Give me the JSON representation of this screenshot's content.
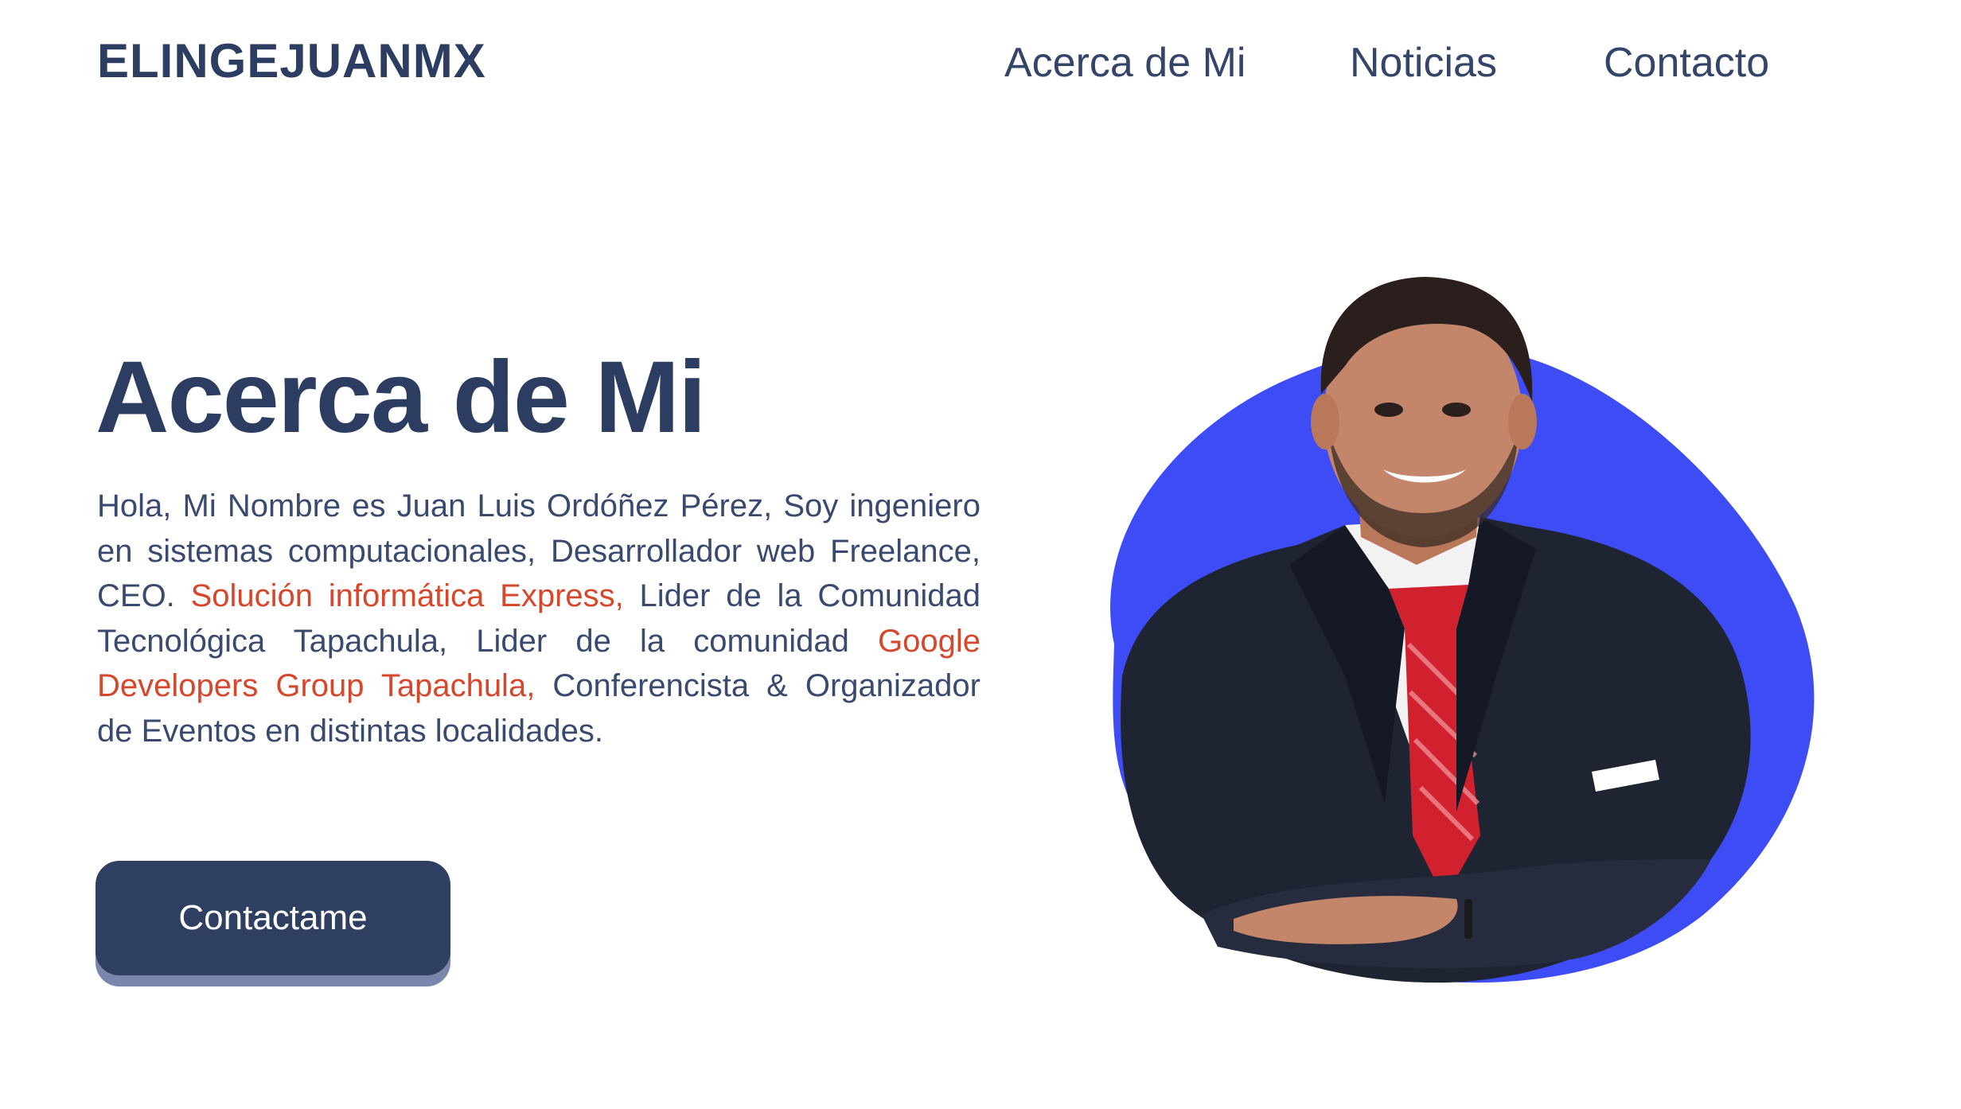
{
  "header": {
    "brand": "ELINGEJUANMX",
    "nav": [
      {
        "label": "Acerca de Mi"
      },
      {
        "label": "Noticias"
      },
      {
        "label": "Contacto"
      }
    ]
  },
  "hero": {
    "title": "Acerca de Mi",
    "paragraph": [
      {
        "text": "Hola, Mi Nombre es Juan Luis Ordóñez Pérez, Soy ingeniero en sistemas computacionales, Desarrollador web Freelance, CEO. ",
        "highlight": false
      },
      {
        "text": "Solución informática Express,",
        "highlight": true
      },
      {
        "text": " Lider de la Comunidad Tecnológica Tapachula, Lider de la comunidad ",
        "highlight": false
      },
      {
        "text": "Google Developers Group Tapachula,",
        "highlight": true
      },
      {
        "text": " Conferencista & Organizador de Eventos en distintas localidades.",
        "highlight": false
      }
    ],
    "cta_label": "Contactame"
  },
  "portrait": {
    "blob_color": "#3d4cf5",
    "suit_color": "#1f2433",
    "tie_color": "#d1212f"
  },
  "colors": {
    "primary": "#2f3f62",
    "accent": "#d6472c",
    "background": "#ffffff"
  }
}
